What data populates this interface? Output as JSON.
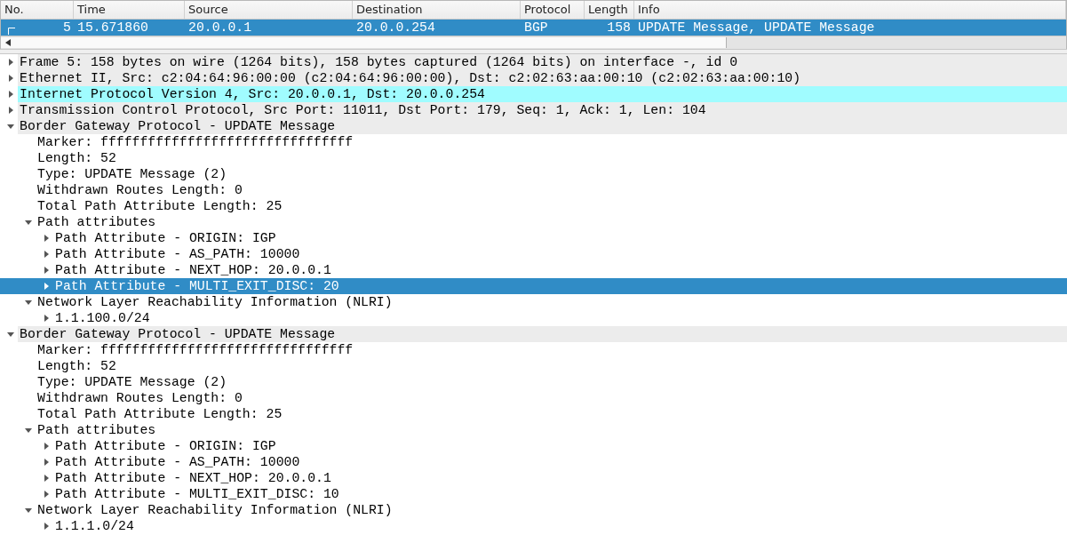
{
  "packet_list": {
    "columns": [
      "No.",
      "Time",
      "Source",
      "Destination",
      "Protocol",
      "Length",
      "Info"
    ],
    "rows": [
      {
        "selected": true,
        "cells": [
          "5",
          "15.671860",
          "20.0.0.1",
          "20.0.0.254",
          "BGP",
          "158",
          "UPDATE Message, UPDATE Message"
        ]
      }
    ]
  },
  "details": [
    {
      "label": "Frame 5: 158 bytes on wire (1264 bits), 158 bytes captured (1264 bits) on interface -, id 0",
      "expanded": false,
      "selected": false,
      "color": "#ececec"
    },
    {
      "label": "Ethernet II, Src: c2:04:64:96:00:00 (c2:04:64:96:00:00), Dst: c2:02:63:aa:00:10 (c2:02:63:aa:00:10)",
      "expanded": false,
      "selected": false,
      "color": "#ececec"
    },
    {
      "label": "Internet Protocol Version 4, Src: 20.0.0.1, Dst: 20.0.0.254",
      "expanded": false,
      "selected": false,
      "color": "#a0fcff"
    },
    {
      "label": "Transmission Control Protocol, Src Port: 11011, Dst Port: 179, Seq: 1, Ack: 1, Len: 104",
      "expanded": false,
      "selected": false,
      "color": "#ececec"
    },
    {
      "label": "Border Gateway Protocol - UPDATE Message",
      "expanded": true,
      "selected": false,
      "color": "#ececec",
      "children": [
        {
          "label": "Marker: ffffffffffffffffffffffffffffffff",
          "selected": false
        },
        {
          "label": "Length: 52",
          "selected": false
        },
        {
          "label": "Type: UPDATE Message (2)",
          "selected": false
        },
        {
          "label": "Withdrawn Routes Length: 0",
          "selected": false
        },
        {
          "label": "Total Path Attribute Length: 25",
          "selected": false
        },
        {
          "label": "Path attributes",
          "expanded": true,
          "selected": false,
          "children": [
            {
              "label": "Path Attribute - ORIGIN: IGP",
              "expanded": false,
              "selected": false
            },
            {
              "label": "Path Attribute - AS_PATH: 10000",
              "expanded": false,
              "selected": false
            },
            {
              "label": "Path Attribute - NEXT_HOP: 20.0.0.1",
              "expanded": false,
              "selected": false
            },
            {
              "label": "Path Attribute - MULTI_EXIT_DISC: 20",
              "expanded": false,
              "selected": true
            }
          ]
        },
        {
          "label": "Network Layer Reachability Information (NLRI)",
          "expanded": true,
          "selected": false,
          "children": [
            {
              "label": "1.1.100.0/24",
              "expanded": false,
              "selected": false
            }
          ]
        }
      ]
    },
    {
      "label": "Border Gateway Protocol - UPDATE Message",
      "expanded": true,
      "selected": false,
      "color": "#ececec",
      "children": [
        {
          "label": "Marker: ffffffffffffffffffffffffffffffff",
          "selected": false
        },
        {
          "label": "Length: 52",
          "selected": false
        },
        {
          "label": "Type: UPDATE Message (2)",
          "selected": false
        },
        {
          "label": "Withdrawn Routes Length: 0",
          "selected": false
        },
        {
          "label": "Total Path Attribute Length: 25",
          "selected": false
        },
        {
          "label": "Path attributes",
          "expanded": true,
          "selected": false,
          "children": [
            {
              "label": "Path Attribute - ORIGIN: IGP",
              "expanded": false,
              "selected": false
            },
            {
              "label": "Path Attribute - AS_PATH: 10000",
              "expanded": false,
              "selected": false
            },
            {
              "label": "Path Attribute - NEXT_HOP: 20.0.0.1",
              "expanded": false,
              "selected": false
            },
            {
              "label": "Path Attribute - MULTI_EXIT_DISC: 10",
              "expanded": false,
              "selected": false
            }
          ]
        },
        {
          "label": "Network Layer Reachability Information (NLRI)",
          "expanded": true,
          "selected": false,
          "children": [
            {
              "label": "1.1.1.0/24",
              "expanded": false,
              "selected": false
            }
          ]
        }
      ]
    }
  ]
}
